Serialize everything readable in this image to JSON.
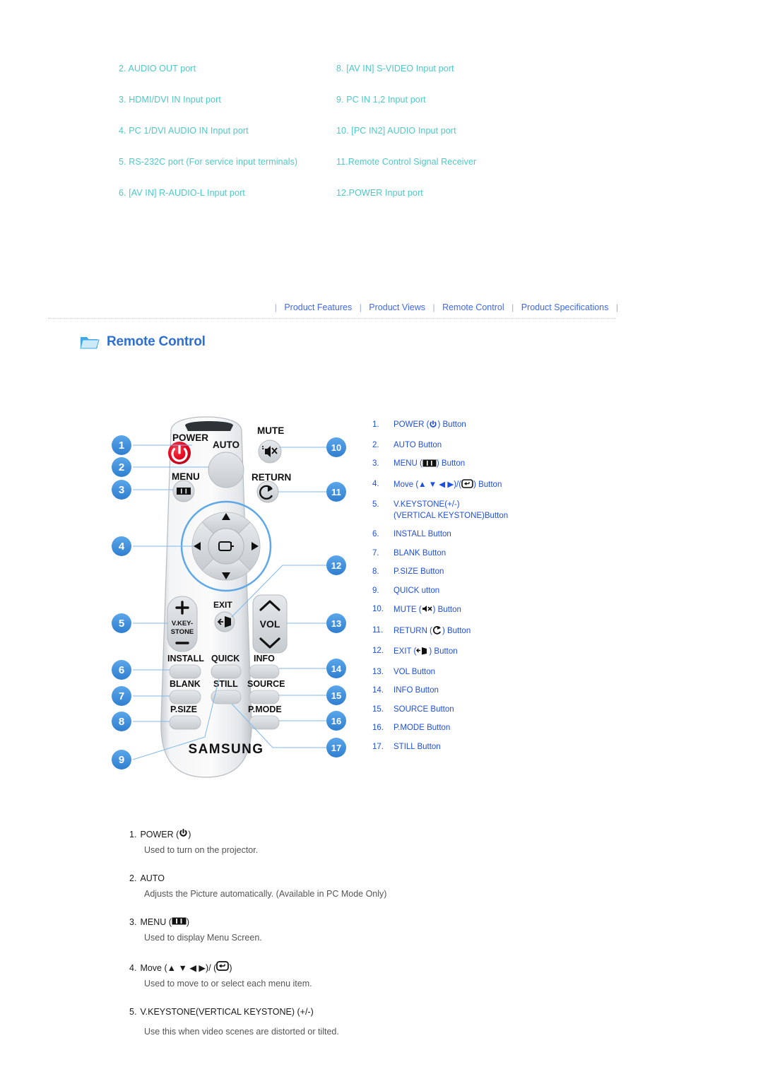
{
  "ports": {
    "left_column": [
      "2. AUDIO OUT port",
      "3. HDMI/DVI IN Input port",
      "4. PC 1/DVI AUDIO IN Input port",
      "5. RS-232C port (For service input terminals)",
      "6. [AV IN] R-AUDIO-L Input port"
    ],
    "right_column": [
      "8. [AV IN] S-VIDEO Input port",
      "9. PC IN 1,2 Input port",
      "10. [PC IN2] AUDIO Input port",
      "11.Remote Control Signal Receiver",
      "12.POWER Input port"
    ]
  },
  "nav": {
    "items": [
      "Product Features",
      "Product Views",
      "Remote Control",
      "Product Specifications"
    ],
    "separator": "|"
  },
  "section": {
    "title": "Remote Control",
    "icon": "folder-icon"
  },
  "remote": {
    "brand": "SAMSUNG",
    "labels": {
      "power": "POWER",
      "auto": "AUTO",
      "menu": "MENU",
      "mute": "MUTE",
      "return": "RETURN",
      "exit": "EXIT",
      "vol": "VOL",
      "vkeystone_line1": "V.KEY-",
      "vkeystone_line2": "STONE",
      "install": "INSTALL",
      "quick": "QUICK",
      "info": "INFO",
      "blank": "BLANK",
      "still": "STILL",
      "source": "SOURCE",
      "psize": "P.SIZE",
      "pmode": "P.MODE",
      "plus": "+",
      "minus": "—"
    },
    "callouts_left": [
      "1",
      "2",
      "3",
      "4",
      "5",
      "6",
      "7",
      "8",
      "9"
    ],
    "callouts_right": [
      "10",
      "11",
      "12",
      "13",
      "14",
      "15",
      "16",
      "17"
    ],
    "colors": {
      "badge": "#3d8fe0",
      "power_button": "#e3001b",
      "body": "#f2f2f2",
      "body_edge": "#c9cdd2",
      "dpad_ring": "#5fa8e8",
      "key_face": "#d5d9dc"
    }
  },
  "legend": {
    "items": [
      {
        "idx": "1.",
        "text": "POWER (",
        "icon": "power-icon",
        "tail": ") Button"
      },
      {
        "idx": "2.",
        "text": "AUTO Button"
      },
      {
        "idx": "3.",
        "text": "MENU (",
        "icon": "menu-icon",
        "tail": ") Button"
      },
      {
        "idx": "4.",
        "text": "Move (",
        "icon": "dpad-enter-icon",
        "tail": ") Button"
      },
      {
        "idx": "5.",
        "text": "V.KEYSTONE(+/-)",
        "sub": "(VERTICAL KEYSTONE)Button"
      },
      {
        "idx": "6.",
        "text": "INSTALL Button"
      },
      {
        "idx": "7.",
        "text": "BLANK Button"
      },
      {
        "idx": "8.",
        "text": "P.SIZE Button"
      },
      {
        "idx": "9.",
        "text": "QUICK utton"
      },
      {
        "idx": "10.",
        "text": "MUTE (",
        "icon": "mute-icon",
        "tail": ") Button"
      },
      {
        "idx": "11.",
        "text": "RETURN (",
        "icon": "return-icon",
        "tail": ") Button"
      },
      {
        "idx": "12.",
        "text": "EXIT (",
        "icon": "exit-icon",
        "tail": ") Button"
      },
      {
        "idx": "13.",
        "text": "VOL Button"
      },
      {
        "idx": "14.",
        "text": "INFO Button"
      },
      {
        "idx": "15.",
        "text": "SOURCE Button"
      },
      {
        "idx": "16.",
        "text": "P.MODE Button"
      },
      {
        "idx": "17.",
        "text": "STILL Button"
      }
    ],
    "move_arrows": "▲ ▼ ◀ ▶",
    "move_mid": ")/("
  },
  "descriptions": [
    {
      "num": "1.",
      "title": "POWER (",
      "title_tail": ")",
      "icon": "power-icon",
      "body": "Used to turn on the projector."
    },
    {
      "num": "2.",
      "title": "AUTO",
      "title_tail": "",
      "body": "Adjusts the Picture automatically. (Available in PC Mode Only)"
    },
    {
      "num": "3.",
      "title": "MENU (",
      "title_tail": ")",
      "icon": "menu-icon",
      "body": "Used to display Menu Screen."
    },
    {
      "num": "4.",
      "title": "Move (▲ ▼ ◀ ▶)/ (",
      "title_tail": ")",
      "icon": "enter-icon",
      "body": "Used to move to or select each menu item."
    },
    {
      "num": "5.",
      "title": "V.KEYSTONE(VERTICAL KEYSTONE) (+/-)",
      "title_tail": "",
      "body": "Use this when video scenes are distorted or tilted."
    }
  ],
  "colors": {
    "teal": "#4dc8c8",
    "nav_blue": "#4169e8",
    "legend_blue": "#1f4fe0",
    "heading_blue": "#2f6fd0",
    "body_gray": "#555555"
  }
}
